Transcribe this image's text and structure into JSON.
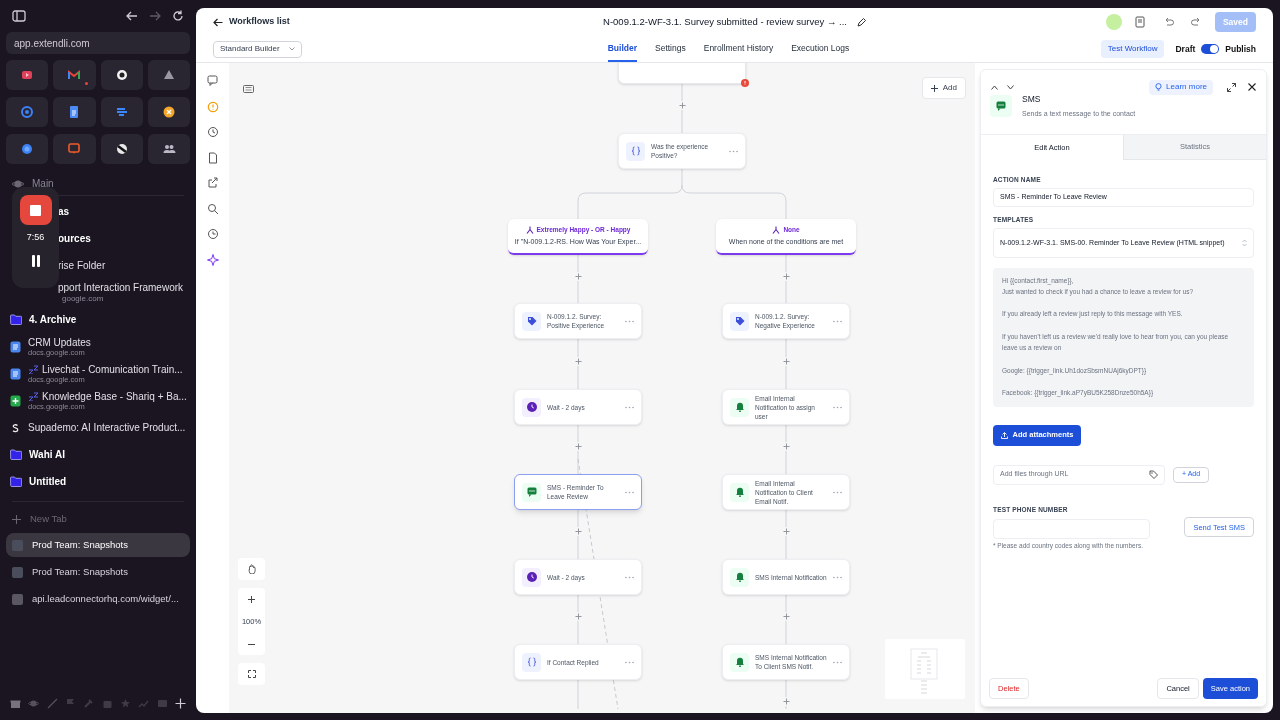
{
  "browser": {
    "url": "app.extendli.com",
    "section": "Main",
    "partly_hidden_items": [
      {
        "kind": "folder",
        "title": "as"
      },
      {
        "kind": "folder",
        "title": "ources"
      },
      {
        "kind": "link",
        "title": "rise Folder"
      },
      {
        "kind": "doc",
        "title": "pport Interaction Framework",
        "subtitle": "google.com"
      }
    ],
    "items": [
      {
        "kind": "folder",
        "title": "4. Archive"
      },
      {
        "kind": "doc",
        "title": "CRM Updates",
        "subtitle": "docs.google.com",
        "asleep": false
      },
      {
        "kind": "doc",
        "title": "Livechat - Comunication Train...",
        "subtitle": "docs.google.com",
        "asleep": true
      },
      {
        "kind": "sheet",
        "title": "Knowledge Base - Shariq + Ba...",
        "subtitle": "docs.google.com",
        "asleep": true
      },
      {
        "kind": "site",
        "title": "Supademo: AI Interactive Product..."
      },
      {
        "kind": "folder",
        "title": "Wahi AI"
      },
      {
        "kind": "folder",
        "title": "Untitled"
      }
    ],
    "new_tab": "New Tab",
    "tabs": [
      {
        "title": "Prod Team: Snapshots",
        "selected": true
      },
      {
        "title": "Prod Team: Snapshots",
        "selected": false
      },
      {
        "title": "api.leadconnectorhq.com/widget/...",
        "selected": false
      }
    ],
    "recorder": {
      "time": "7:56"
    }
  },
  "app": {
    "back_label": "Workflows list",
    "title": "N-009.1.2-WF-3.1. Survey submitted - review survey → ...",
    "save_button": "Saved",
    "builder_mode": "Standard Builder",
    "tabs": [
      {
        "label": "Builder",
        "selected": true
      },
      {
        "label": "Settings",
        "selected": false
      },
      {
        "label": "Enrollment History",
        "selected": false
      },
      {
        "label": "Execution Logs",
        "selected": false
      }
    ],
    "test_button": "Test Workflow",
    "draft_label": "Draft",
    "publish_label": "Publish",
    "published": true
  },
  "canvas": {
    "add_button": "Add",
    "zoom": "100%",
    "trigger_error": true,
    "condition": {
      "title": "Was the experience Positive?"
    },
    "branches": [
      {
        "label": "Extremely Happy - OR - Happy",
        "description": "If \"N-009.1.2-RS. How Was Your Exper...",
        "steps": [
          {
            "kind": "tag",
            "title": "N-009.1.2. Survey: Positive Experience",
            "selected": false
          },
          {
            "kind": "wait",
            "title": "Wait - 2 days",
            "selected": false
          },
          {
            "kind": "sms",
            "title": "SMS - Reminder To Leave Review",
            "selected": true
          },
          {
            "kind": "wait",
            "title": "Wait - 2 days",
            "selected": false
          },
          {
            "kind": "condition",
            "title": "If Contact Replied",
            "selected": false
          }
        ]
      },
      {
        "label": "None",
        "description": "When none of the conditions are met",
        "steps": [
          {
            "kind": "tag",
            "title": "N-009.1.2. Survey: Negative Experience",
            "selected": false
          },
          {
            "kind": "notification",
            "title": "Email Internal Notification to assign user",
            "selected": false
          },
          {
            "kind": "notification",
            "title": "Email Internal Notification to Client Email Notif.",
            "selected": false
          },
          {
            "kind": "notification",
            "title": "SMS Internal Notification",
            "selected": false
          },
          {
            "kind": "notification",
            "title": "SMS Internal Notification To Client SMS Notif.",
            "selected": false
          }
        ]
      }
    ]
  },
  "panel": {
    "title": "SMS",
    "subtitle": "Sends a text message to the contact",
    "learn_more": "Learn more",
    "tabs": [
      {
        "label": "Edit Action",
        "selected": true
      },
      {
        "label": "Statistics",
        "selected": false
      }
    ],
    "action_name_label": "ACTION NAME",
    "action_name": "SMS - Reminder To Leave Review",
    "templates_label": "TEMPLATES",
    "template": "N-009.1.2-WF-3.1. SMS-00. Reminder To Leave Review (HTML snippet)",
    "message": "Hi {{contact.first_name}},\nJust wanted to check if you had a chance to leave a review for us?\n\nIf you already left a review just reply to this message with YES.\n\nIf you haven't left us a review we'd really love to hear from you, can you please leave us a review on\n\nGoogle: {{trigger_link.Uh1dozSbsmNUAj6kyDPT}}\n\nFacebook: {{trigger_link.aP7yBU5K258Dnze50h5A}}",
    "attach_button": "Add attachments",
    "url_placeholder": "Add files through URL",
    "add_url_button": "+ Add",
    "phone_label": "TEST PHONE NUMBER",
    "phone_hint": "* Please add country codes along with the numbers.",
    "send_test_button": "Send Test SMS",
    "delete_button": "Delete",
    "cancel_button": "Cancel",
    "save_button": "Save action"
  }
}
